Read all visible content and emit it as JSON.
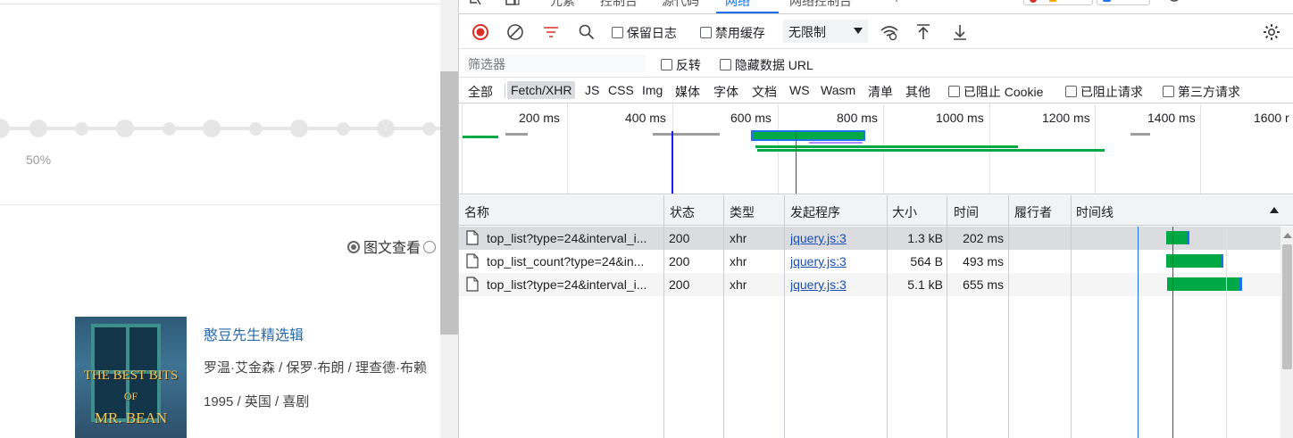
{
  "webpage": {
    "progress_label": "50%",
    "view_mode_label": "图文查看",
    "movie": {
      "cover_line1": "THE BEST BITS",
      "cover_line2": "OF",
      "cover_line3": "MR. BEAN",
      "title": "憨豆先生精选辑",
      "cast": "罗温·艾金森 / 保罗·布朗 / 理查德·布赖",
      "meta": "1995 / 英国 / 喜剧"
    }
  },
  "devtools": {
    "tabs": [
      "元素",
      "控制台",
      "源代码",
      "网络",
      "网络控制台"
    ],
    "active_tab": "网络",
    "toolbar": {
      "preserve_log": "保留日志",
      "disable_cache": "禁用缓存",
      "throttle": "无限制"
    },
    "filter": {
      "placeholder": "筛选器",
      "invert": "反转",
      "hide_data_urls": "隐藏数据 URL"
    },
    "types": [
      "全部",
      "Fetch/XHR",
      "JS",
      "CSS",
      "Img",
      "媒体",
      "字体",
      "文档",
      "WS",
      "Wasm",
      "清单",
      "其他"
    ],
    "active_type": "Fetch/XHR",
    "type_checks": [
      "已阻止 Cookie",
      "已阻止请求",
      "第三方请求"
    ],
    "overview_ticks": [
      "200 ms",
      "400 ms",
      "600 ms",
      "800 ms",
      "1000 ms",
      "1200 ms",
      "1400 ms",
      "1600 r"
    ],
    "columns": [
      "名称",
      "状态",
      "类型",
      "发起程序",
      "大小",
      "时间",
      "履行者",
      "时间线"
    ],
    "rows": [
      {
        "name": "top_list?type=24&interval_i...",
        "status": "200",
        "type": "xhr",
        "initiator": "jquery.js:3",
        "size": "1.3 kB",
        "time": "202 ms",
        "fulfilled": "",
        "bar_start_ms": 655,
        "bar_end_ms": 857
      },
      {
        "name": "top_list_count?type=24&in...",
        "status": "200",
        "type": "xhr",
        "initiator": "jquery.js:3",
        "size": "564 B",
        "time": "493 ms",
        "fulfilled": "",
        "bar_start_ms": 655,
        "bar_end_ms": 1148
      },
      {
        "name": "top_list?type=24&interval_i...",
        "status": "200",
        "type": "xhr",
        "initiator": "jquery.js:3",
        "size": "5.1 kB",
        "time": "655 ms",
        "fulfilled": "",
        "bar_start_ms": 660,
        "bar_end_ms": 1315
      }
    ],
    "colors": {
      "accent": "#1a73e8",
      "waiting": "#00a846",
      "download": "#1a73e8",
      "dom_content_loaded": "#1a1aff",
      "load": "#c82020"
    }
  }
}
